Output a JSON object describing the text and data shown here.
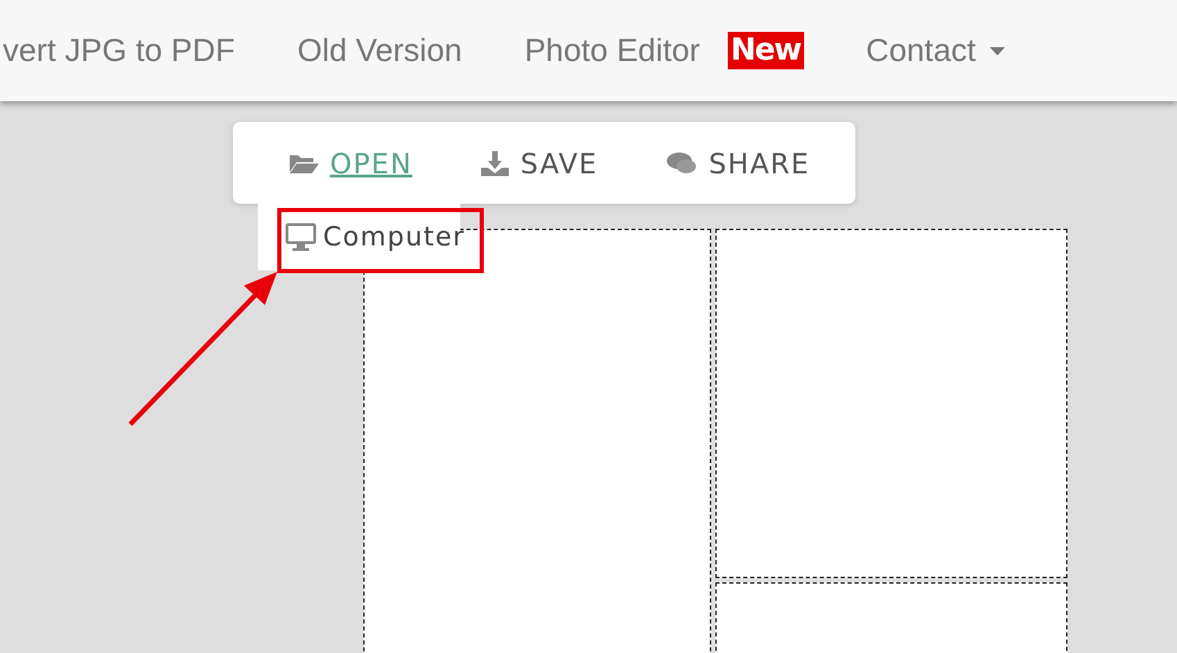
{
  "nav": {
    "items": [
      {
        "label": "vert JPG to PDF"
      },
      {
        "label": "Old Version"
      },
      {
        "label": "Photo Editor",
        "badge": "New"
      },
      {
        "label": "Contact",
        "dropdown": true
      }
    ]
  },
  "toolbar": {
    "tabs": [
      {
        "label": "OPEN",
        "selected": true
      },
      {
        "label": "SAVE",
        "selected": false
      },
      {
        "label": "SHARE",
        "selected": false
      }
    ]
  },
  "open_menu": {
    "items": [
      {
        "label": "Computer"
      }
    ]
  }
}
